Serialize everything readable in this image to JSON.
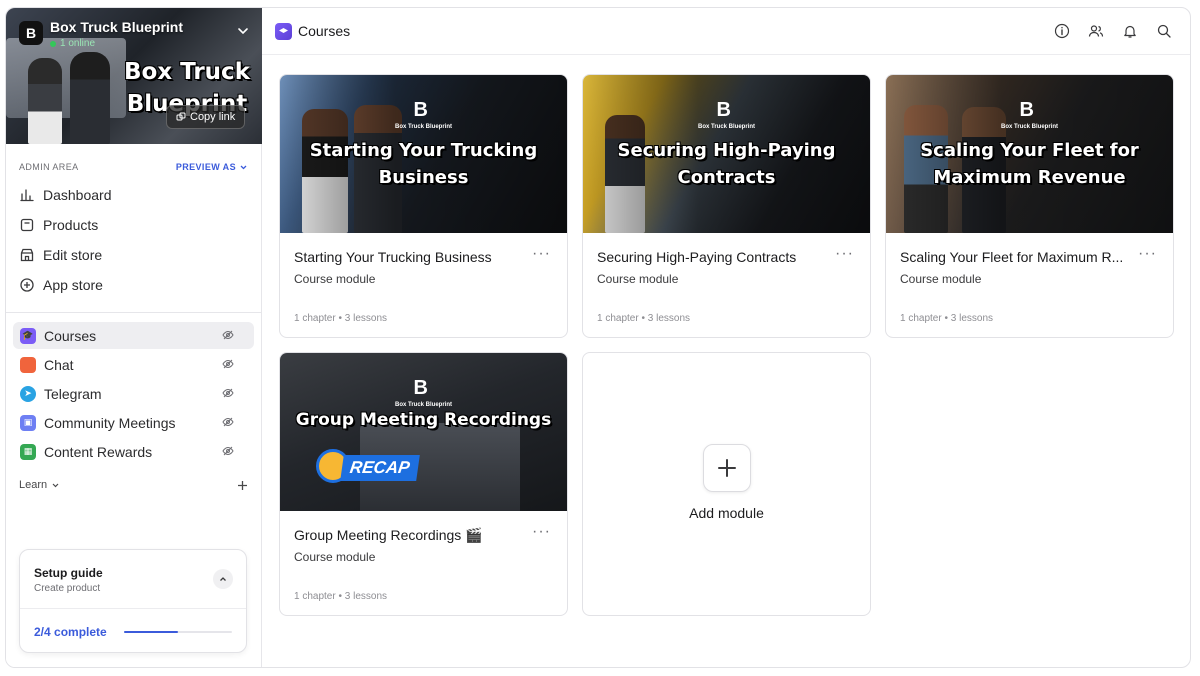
{
  "store": {
    "name": "Box Truck Blueprint",
    "online": "1 online",
    "banner_title": "Box Truck Blueprint",
    "copy_link": "Copy link",
    "logo_letter": "B"
  },
  "sidebar": {
    "admin_label": "ADMIN AREA",
    "preview_as": "PREVIEW AS",
    "nav": [
      {
        "label": "Dashboard",
        "icon": "chart-icon"
      },
      {
        "label": "Products",
        "icon": "box-icon"
      },
      {
        "label": "Edit store",
        "icon": "store-icon"
      },
      {
        "label": "App store",
        "icon": "plus-circle-icon"
      }
    ],
    "apps": [
      {
        "label": "Courses",
        "icon": "courses-icon",
        "color": "#7b5cf6",
        "active": true
      },
      {
        "label": "Chat",
        "icon": "chat-icon",
        "color": "#f0643c"
      },
      {
        "label": "Telegram",
        "icon": "telegram-icon",
        "color": "#2aa3e3"
      },
      {
        "label": "Community Meetings",
        "icon": "meetings-icon",
        "color": "#6e7ff3"
      },
      {
        "label": "Content Rewards",
        "icon": "rewards-icon",
        "color": "#34a853"
      }
    ],
    "learn": "Learn",
    "setup": {
      "title": "Setup guide",
      "subtitle": "Create product",
      "progress_text": "2/4 complete",
      "progress": 0.5
    }
  },
  "header": {
    "title": "Courses"
  },
  "courses": [
    {
      "title": "Starting Your Trucking Business",
      "thumb_title": "Starting Your Trucking Business",
      "logo_text": "Box Truck Blueprint",
      "subtitle": "Course module",
      "chapters": "1 chapter",
      "lessons": "3 lessons"
    },
    {
      "title": "Securing High-Paying Contracts",
      "thumb_title": "Securing High-Paying Contracts",
      "logo_text": "Box Truck Blueprint",
      "subtitle": "Course module",
      "chapters": "1 chapter",
      "lessons": "3 lessons"
    },
    {
      "title": "Scaling Your Fleet for Maximum R...",
      "thumb_title": "Scaling Your Fleet for Maximum Revenue",
      "logo_text": "Box Truck Blueprint",
      "subtitle": "Course module",
      "chapters": "1 chapter",
      "lessons": "3 lessons"
    },
    {
      "title": "Group Meeting Recordings 🎬",
      "thumb_title": "Group Meeting Recordings",
      "logo_text": "Box Truck Blueprint",
      "recap": "RECAP",
      "subtitle": "Course module",
      "chapters": "1 chapter",
      "lessons": "3 lessons"
    }
  ],
  "add_module": "Add module",
  "separator": "•"
}
